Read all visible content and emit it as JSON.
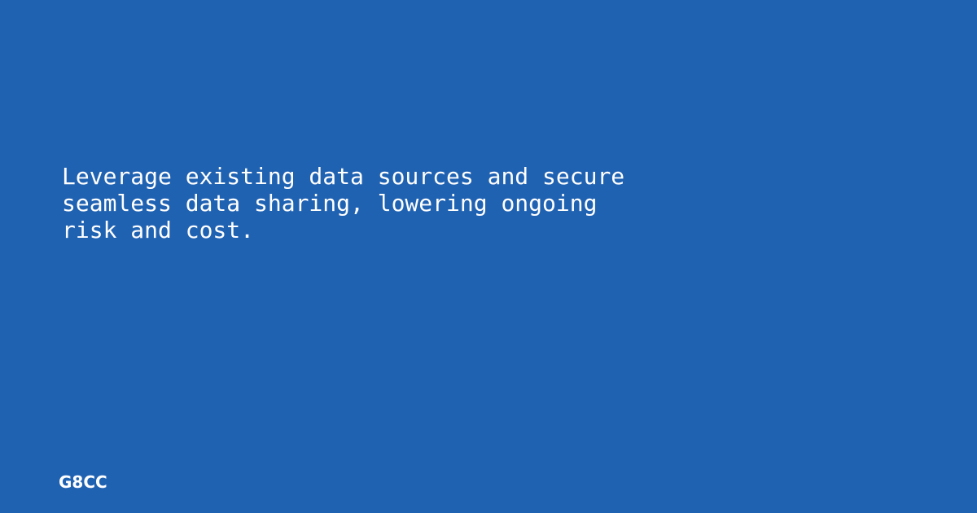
{
  "headline": "Leverage existing data sources and secure\nseamless data sharing, lowering ongoing\nrisk and cost.",
  "brand": "G8CC",
  "colors": {
    "background": "#2062b2",
    "text": "#ffffff"
  }
}
